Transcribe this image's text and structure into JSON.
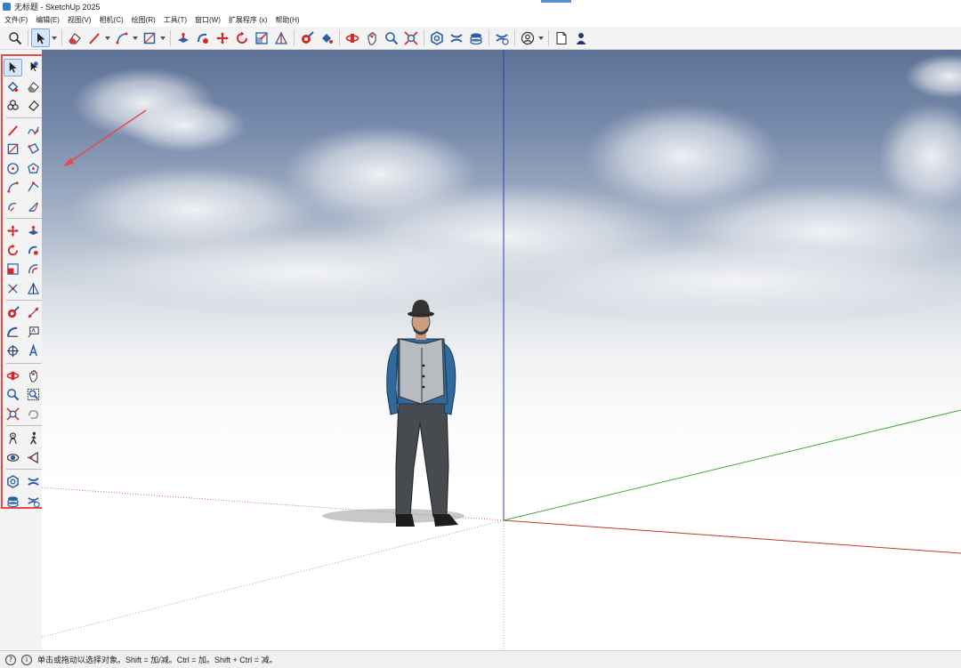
{
  "window": {
    "title": "无标题 - SketchUp 2025"
  },
  "menu": [
    "文件(F)",
    "编辑(E)",
    "视图(V)",
    "相机(C)",
    "绘图(R)",
    "工具(T)",
    "窗口(W)",
    "扩展程序 (x)",
    "帮助(H)"
  ],
  "status": {
    "message": "单击或拖动以选择对象。Shift = 加/减。Ctrl = 加。Shift + Ctrl = 减。"
  },
  "colors": {
    "palette_highlight": "#e84a4a",
    "axis_red": "#c0392b",
    "axis_green": "#3cae3c",
    "axis_blue": "#2a3fb0"
  }
}
